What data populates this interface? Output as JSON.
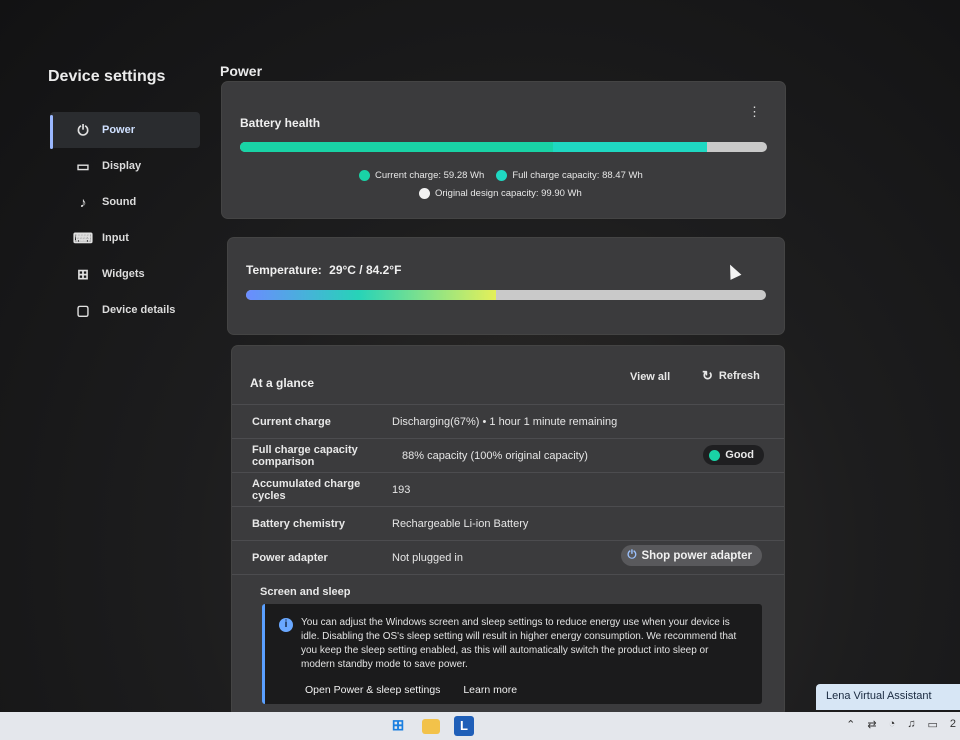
{
  "app": {
    "title": "Device settings"
  },
  "sidebar": {
    "items": [
      {
        "label": "Power",
        "icon": "power-plug-icon",
        "active": true
      },
      {
        "label": "Display",
        "icon": "monitor-icon"
      },
      {
        "label": "Sound",
        "icon": "music-note-icon"
      },
      {
        "label": "Input",
        "icon": "keyboard-icon"
      },
      {
        "label": "Widgets",
        "icon": "widgets-icon"
      },
      {
        "label": "Device details",
        "icon": "laptop-icon"
      }
    ]
  },
  "main": {
    "section_title": "Power",
    "battery_health": {
      "title": "Battery health",
      "more_label": "⋮",
      "current_charge": "Current charge: 59.28 Wh",
      "full_charge_capacity": "Full charge capacity: 88.47 Wh",
      "design_capacity": "Original design capacity: 99.90 Wh",
      "current_fraction": 0.593,
      "full_fraction": 0.886,
      "colors": {
        "current": "#19d3a6",
        "full": "#1fd8c2",
        "design": "#c9c9c9"
      }
    },
    "temperature": {
      "label": "Temperature:",
      "value": "29°C / 84.2°F",
      "fraction": 0.48
    },
    "glance": {
      "title": "At a glance",
      "view_all": "View all",
      "refresh": "Refresh",
      "rows": [
        {
          "label": "Current charge",
          "value": "Discharging(67%)  •  1 hour 1 minute remaining"
        },
        {
          "label": "Full charge capacity comparison",
          "value": "88% capacity (100% original capacity)",
          "badge": "Good"
        },
        {
          "label": "Accumulated charge cycles",
          "value": "193"
        },
        {
          "label": "Battery chemistry",
          "value": "Rechargeable Li-ion Battery"
        },
        {
          "label": "Power adapter",
          "value": "Not plugged in",
          "button": "Shop power adapter"
        }
      ],
      "screen_sleep": {
        "title": "Screen and sleep",
        "info": "You can adjust the Windows screen and sleep settings to reduce energy use when your device is idle. Disabling the OS's sleep setting will result in higher energy consumption. We recommend that you keep the sleep setting enabled, as this will automatically switch the product into sleep or modern standby mode to save power.",
        "link_settings": "Open Power & sleep settings",
        "link_learn": "Learn more"
      }
    }
  },
  "assistant": {
    "label": "Lena Virtual Assistant"
  },
  "taskbar": {
    "apps": [
      "windows-start-icon",
      "file-explorer-icon",
      "lenovo-l-icon"
    ],
    "lenovo_letter": "L",
    "clock_fragment": "2"
  }
}
